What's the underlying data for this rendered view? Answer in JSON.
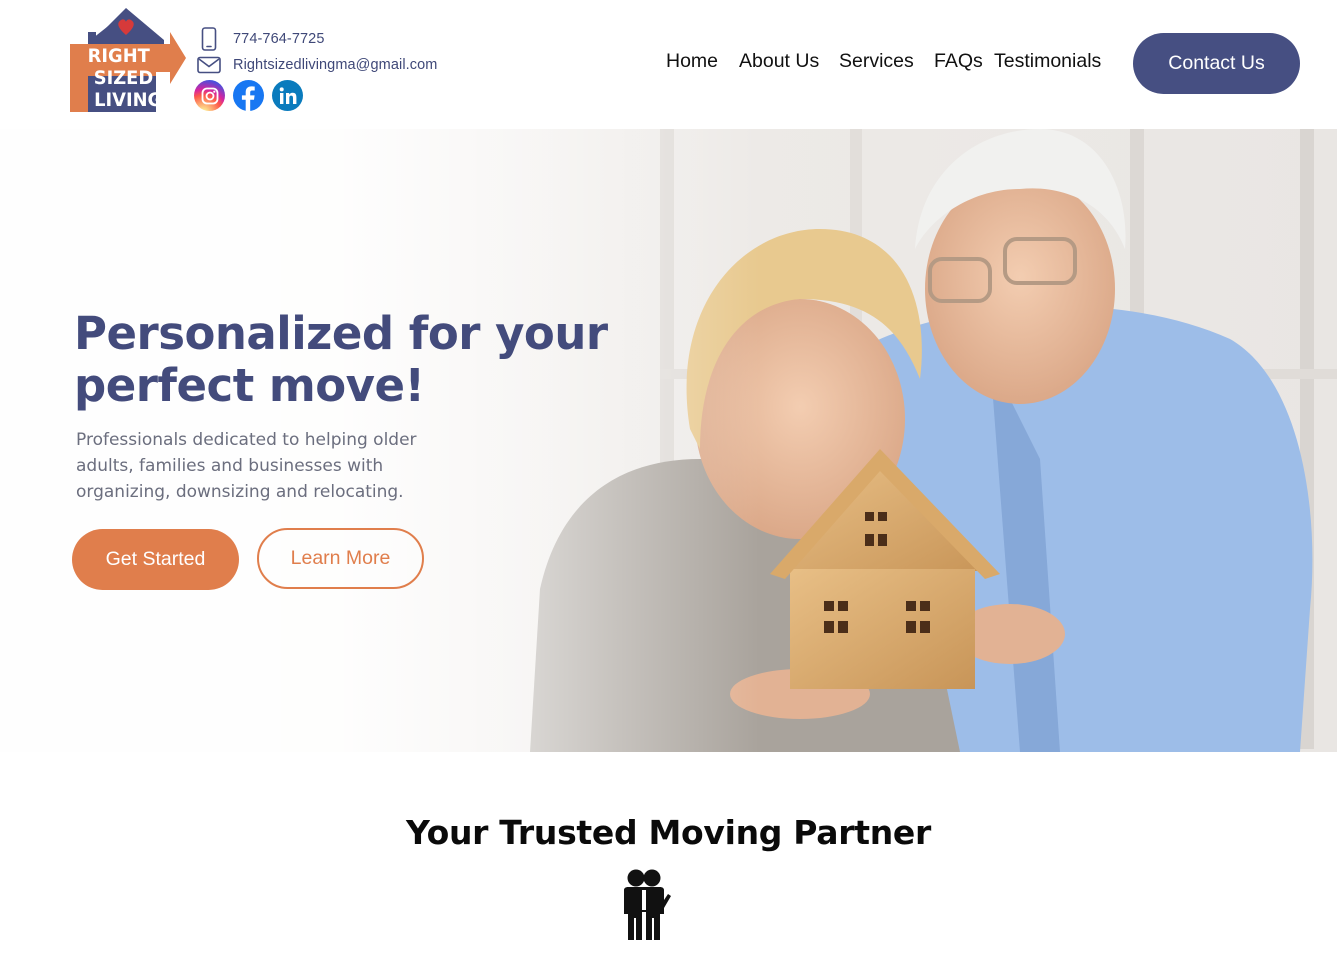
{
  "brand": {
    "logo_lines": [
      "RIGHT",
      "SIZED",
      "LIVING"
    ],
    "logo_icon": "house-heart-logo",
    "colors": {
      "navy": "#464f82",
      "orange": "#e07e4c",
      "heart": "#d63a3a"
    }
  },
  "contact": {
    "phone": "774-764-7725",
    "phone_icon": "phone-icon",
    "email": "Rightsizedlivingma@gmail.com",
    "email_icon": "mail-icon"
  },
  "socials": [
    {
      "name": "instagram-icon"
    },
    {
      "name": "facebook-icon"
    },
    {
      "name": "linkedin-icon"
    }
  ],
  "nav": {
    "items": [
      "Home",
      "About Us",
      "Services",
      "FAQs",
      "Testimonials"
    ],
    "cta": "Contact Us"
  },
  "hero": {
    "title": "Personalized for your perfect move!",
    "subtitle": "Professionals dedicated to helping older adults, families and businesses with organizing, downsizing and relocating.",
    "primary_button": "Get Started",
    "secondary_button": "Learn More"
  },
  "section": {
    "title": "Your Trusted Moving Partner",
    "icon": "people-icon"
  }
}
